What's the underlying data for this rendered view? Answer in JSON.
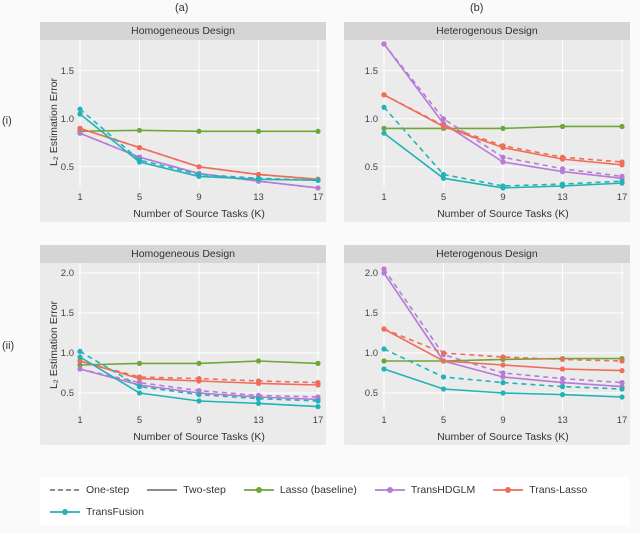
{
  "colLabels": {
    "a": "(a)",
    "b": "(b)"
  },
  "rowLabels": {
    "i": "(i)",
    "ii": "(ii)"
  },
  "strips": {
    "homo": "Homogeneous Design",
    "hetero": "Heterogenous Design"
  },
  "ylabel": "L₂ Estimation Error",
  "ylabel_sub": "2",
  "xlabel": "Number of Source Tasks (K)",
  "legend": {
    "linetype": {
      "one": "One-step",
      "two": "Two-step"
    },
    "methods": {
      "lasso": "Lasso (baseline)",
      "transhdglm": "TransHDGLM",
      "translasso": "Trans-Lasso",
      "transfusion": "TransFusion"
    }
  },
  "colors": {
    "lasso": "#6fa63a",
    "transhdglm": "#b67bd6",
    "translasso": "#ef6d59",
    "transfusion": "#21b3b8"
  },
  "chart_data": [
    {
      "row": "i",
      "col": "a",
      "strip": "Homogeneous Design",
      "x": [
        1,
        5,
        9,
        13,
        17
      ],
      "ylim": [
        0.3,
        1.8
      ],
      "series": [
        {
          "name": "Lasso (baseline)",
          "method": "lasso",
          "linetype": "two",
          "y": [
            0.87,
            0.88,
            0.87,
            0.87,
            0.87
          ]
        },
        {
          "name": "TransHDGLM one",
          "method": "transhdglm",
          "linetype": "one",
          "y": [
            0.85,
            0.6,
            0.43,
            0.35,
            0.28
          ]
        },
        {
          "name": "TransHDGLM two",
          "method": "transhdglm",
          "linetype": "two",
          "y": [
            0.85,
            0.6,
            0.43,
            0.35,
            0.28
          ]
        },
        {
          "name": "Trans-Lasso one",
          "method": "translasso",
          "linetype": "one",
          "y": [
            0.9,
            0.7,
            0.5,
            0.42,
            0.37
          ]
        },
        {
          "name": "Trans-Lasso two",
          "method": "translasso",
          "linetype": "two",
          "y": [
            0.9,
            0.7,
            0.5,
            0.42,
            0.37
          ]
        },
        {
          "name": "TransFusion one",
          "method": "transfusion",
          "linetype": "one",
          "y": [
            1.1,
            0.57,
            0.42,
            0.38,
            0.36
          ]
        },
        {
          "name": "TransFusion two",
          "method": "transfusion",
          "linetype": "two",
          "y": [
            1.05,
            0.55,
            0.4,
            0.37,
            0.36
          ]
        }
      ]
    },
    {
      "row": "i",
      "col": "b",
      "strip": "Heterogenous Design",
      "x": [
        1,
        5,
        9,
        13,
        17
      ],
      "ylim": [
        0.3,
        1.8
      ],
      "series": [
        {
          "name": "Lasso (baseline)",
          "method": "lasso",
          "linetype": "two",
          "y": [
            0.9,
            0.9,
            0.9,
            0.92,
            0.92
          ]
        },
        {
          "name": "TransHDGLM one",
          "method": "transhdglm",
          "linetype": "one",
          "y": [
            1.78,
            1.0,
            0.6,
            0.48,
            0.4
          ]
        },
        {
          "name": "TransHDGLM two",
          "method": "transhdglm",
          "linetype": "two",
          "y": [
            1.78,
            0.95,
            0.55,
            0.45,
            0.38
          ]
        },
        {
          "name": "Trans-Lasso one",
          "method": "translasso",
          "linetype": "one",
          "y": [
            1.25,
            0.93,
            0.72,
            0.6,
            0.55
          ]
        },
        {
          "name": "Trans-Lasso two",
          "method": "translasso",
          "linetype": "two",
          "y": [
            1.25,
            0.92,
            0.7,
            0.58,
            0.52
          ]
        },
        {
          "name": "TransFusion one",
          "method": "transfusion",
          "linetype": "one",
          "y": [
            1.12,
            0.42,
            0.3,
            0.32,
            0.35
          ]
        },
        {
          "name": "TransFusion two",
          "method": "transfusion",
          "linetype": "two",
          "y": [
            0.85,
            0.38,
            0.28,
            0.3,
            0.33
          ]
        }
      ]
    },
    {
      "row": "ii",
      "col": "a",
      "strip": "Homogeneous Design",
      "x": [
        1,
        5,
        9,
        13,
        17
      ],
      "ylim": [
        0.3,
        2.1
      ],
      "series": [
        {
          "name": "Lasso (baseline)",
          "method": "lasso",
          "linetype": "two",
          "y": [
            0.85,
            0.87,
            0.87,
            0.9,
            0.87
          ]
        },
        {
          "name": "TransHDGLM one",
          "method": "transhdglm",
          "linetype": "one",
          "y": [
            0.8,
            0.63,
            0.53,
            0.47,
            0.45
          ]
        },
        {
          "name": "TransHDGLM two",
          "method": "transhdglm",
          "linetype": "two",
          "y": [
            0.8,
            0.6,
            0.5,
            0.45,
            0.42
          ]
        },
        {
          "name": "Trans-Lasso one",
          "method": "translasso",
          "linetype": "one",
          "y": [
            0.9,
            0.7,
            0.68,
            0.65,
            0.63
          ]
        },
        {
          "name": "Trans-Lasso two",
          "method": "translasso",
          "linetype": "two",
          "y": [
            0.9,
            0.68,
            0.65,
            0.62,
            0.6
          ]
        },
        {
          "name": "TransFusion one",
          "method": "transfusion",
          "linetype": "one",
          "y": [
            1.02,
            0.58,
            0.48,
            0.43,
            0.4
          ]
        },
        {
          "name": "TransFusion two",
          "method": "transfusion",
          "linetype": "two",
          "y": [
            0.95,
            0.5,
            0.4,
            0.37,
            0.33
          ]
        }
      ]
    },
    {
      "row": "ii",
      "col": "b",
      "strip": "Heterogenous Design",
      "x": [
        1,
        5,
        9,
        13,
        17
      ],
      "ylim": [
        0.3,
        2.1
      ],
      "series": [
        {
          "name": "Lasso (baseline)",
          "method": "lasso",
          "linetype": "two",
          "y": [
            0.9,
            0.9,
            0.92,
            0.93,
            0.93
          ]
        },
        {
          "name": "TransHDGLM one",
          "method": "transhdglm",
          "linetype": "one",
          "y": [
            2.05,
            0.98,
            0.75,
            0.68,
            0.63
          ]
        },
        {
          "name": "TransHDGLM two",
          "method": "transhdglm",
          "linetype": "two",
          "y": [
            2.0,
            0.9,
            0.7,
            0.63,
            0.58
          ]
        },
        {
          "name": "Trans-Lasso one",
          "method": "translasso",
          "linetype": "one",
          "y": [
            1.3,
            1.0,
            0.95,
            0.92,
            0.9
          ]
        },
        {
          "name": "Trans-Lasso two",
          "method": "translasso",
          "linetype": "two",
          "y": [
            1.3,
            0.9,
            0.85,
            0.8,
            0.78
          ]
        },
        {
          "name": "TransFusion one",
          "method": "transfusion",
          "linetype": "one",
          "y": [
            1.05,
            0.7,
            0.63,
            0.58,
            0.55
          ]
        },
        {
          "name": "TransFusion two",
          "method": "transfusion",
          "linetype": "two",
          "y": [
            0.8,
            0.55,
            0.5,
            0.48,
            0.45
          ]
        }
      ]
    }
  ]
}
